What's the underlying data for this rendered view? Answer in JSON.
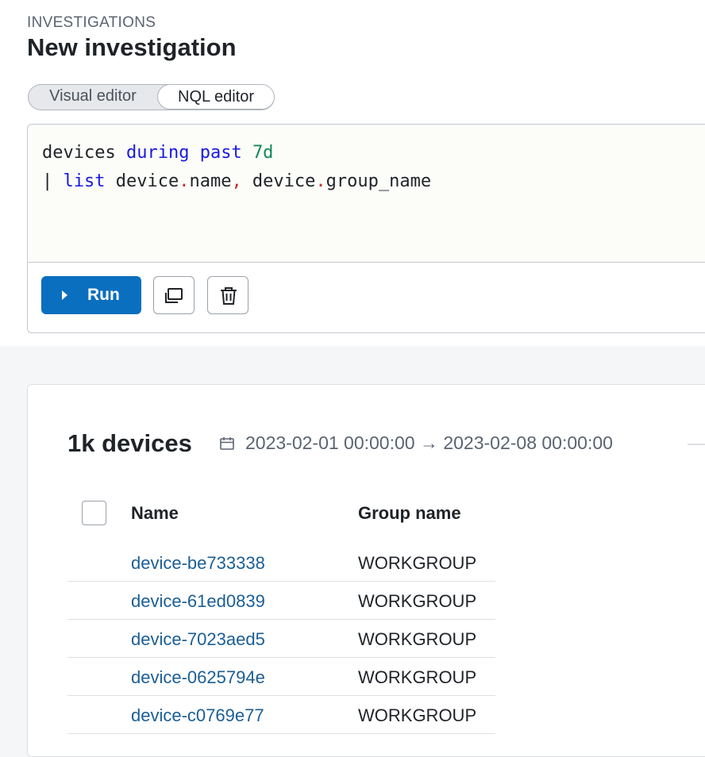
{
  "header": {
    "breadcrumb": "INVESTIGATIONS",
    "title": "New investigation"
  },
  "mode_toggle": {
    "visual_label": "Visual editor",
    "nql_label": "NQL editor",
    "selected": "NQL editor"
  },
  "editor": {
    "line1": {
      "t1": "devices ",
      "t2": "during",
      "t3": " ",
      "t4": "past",
      "t5": " ",
      "t6": "7d"
    },
    "line2": {
      "t1": "| ",
      "t2": "list",
      "t3": " device",
      "t4": ".",
      "t5": "name",
      "t6": ",",
      "t7": " device",
      "t8": ".",
      "t9": "group_name"
    },
    "syntax_colors": {
      "keyword": "#1a1ae0",
      "number": "#108a5a",
      "punctuation": "#c4322d"
    }
  },
  "actions": {
    "run_label": "Run",
    "run_color": "#0b6fbf",
    "duplicate_icon": "duplicate-icon",
    "delete_icon": "trash-icon"
  },
  "results": {
    "count_label": "1k devices",
    "date_range": "2023-02-01 00:00:00 → 2023-02-08 00:00:00",
    "columns": [
      "Name",
      "Group name"
    ],
    "rows": [
      {
        "name": "device-be733338",
        "group": "WORKGROUP"
      },
      {
        "name": "device-61ed0839",
        "group": "WORKGROUP"
      },
      {
        "name": "device-7023aed5",
        "group": "WORKGROUP"
      },
      {
        "name": "device-0625794e",
        "group": "WORKGROUP"
      },
      {
        "name": "device-c0769e77",
        "group": "WORKGROUP"
      }
    ]
  }
}
